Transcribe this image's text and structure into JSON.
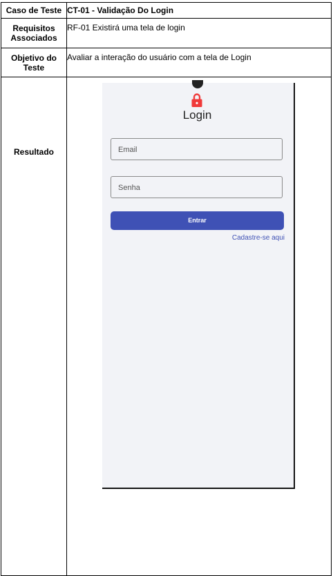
{
  "rows": {
    "caso": {
      "label": "Caso de Teste",
      "value": "CT-01 - Validação Do Login"
    },
    "requisitos": {
      "label": "Requisitos Associados",
      "value": "RF-01 Existirá uma tela de login"
    },
    "objetivo": {
      "label": "Objetivo do Teste",
      "value": "Avaliar a interação do usuário com a tela de Login"
    },
    "resultado": {
      "label": "Resultado"
    }
  },
  "screenshot": {
    "title": "Login",
    "email_placeholder": "Email",
    "senha_placeholder": "Senha",
    "button_label": "Entrar",
    "signup_link": "Cadastre-se aqui",
    "icons": {
      "lock": "lock-icon"
    },
    "colors": {
      "accent": "#3f51b5",
      "lock": "#f03a3a",
      "background": "#f2f3f7"
    }
  }
}
